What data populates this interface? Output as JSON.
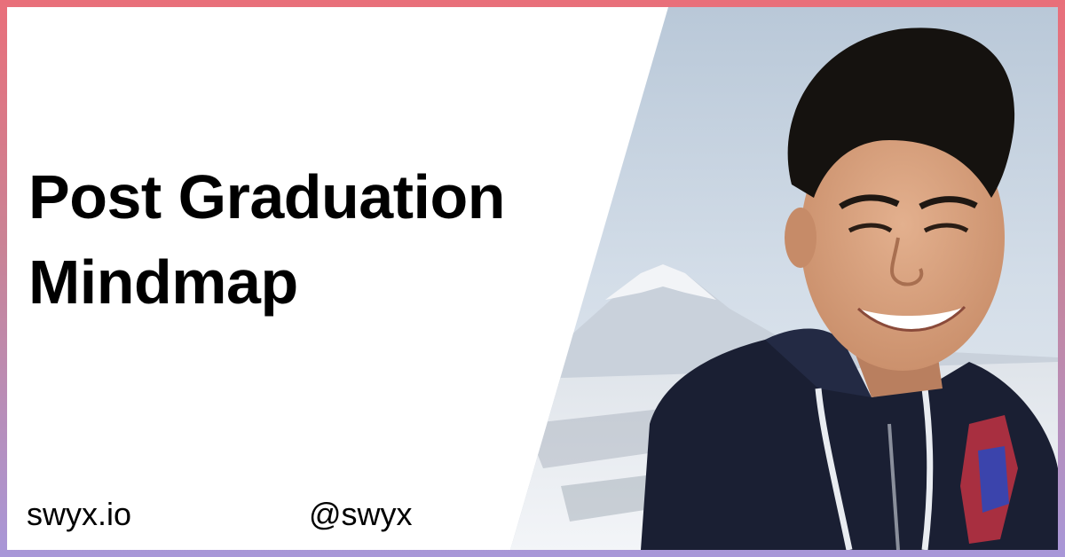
{
  "card": {
    "title_lines": [
      "Post Graduation",
      "Mindmap"
    ],
    "site": "swyx.io",
    "handle": "@swyx"
  },
  "photo": {
    "subject": "portrait-photo",
    "scene": [
      "sky",
      "snowy-mountain",
      "person-in-hoodie"
    ]
  },
  "colors": {
    "frame_top": "#e96f7a",
    "frame_bottom": "#a897d8",
    "card_bg": "#ffffff",
    "text": "#000000"
  }
}
